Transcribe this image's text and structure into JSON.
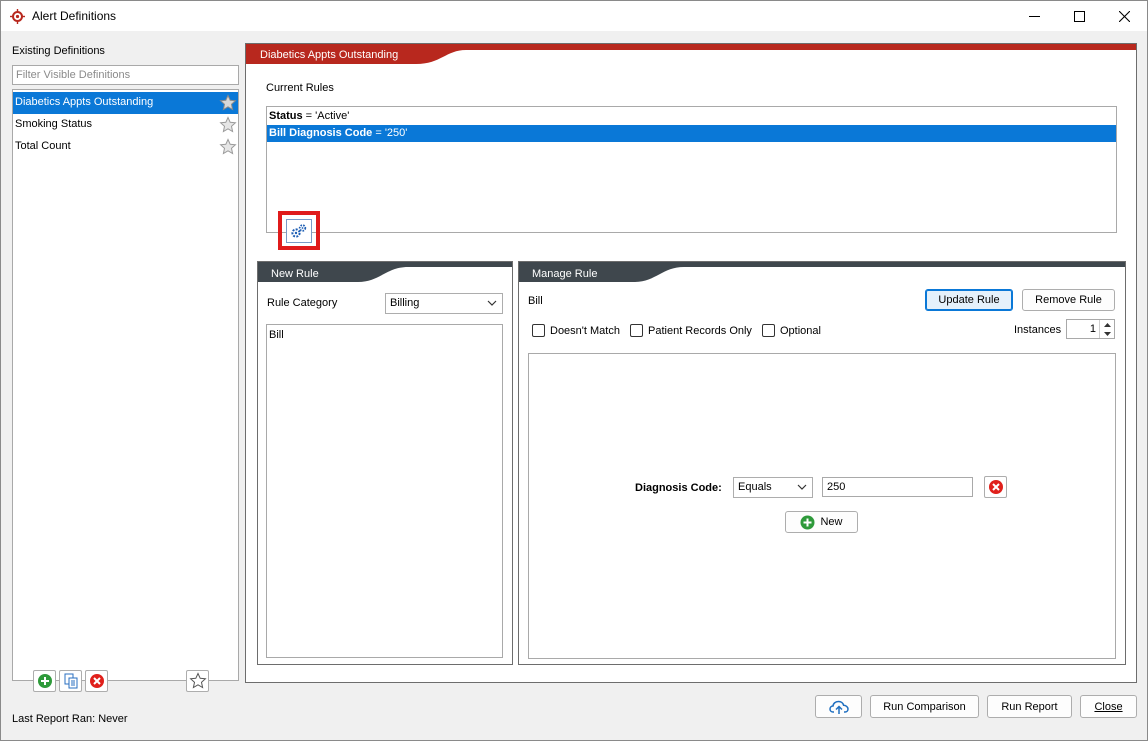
{
  "window": {
    "title": "Alert Definitions",
    "accent_color": "#b8281e",
    "selection_color": "#0a78d7"
  },
  "sidebar": {
    "heading": "Existing Definitions",
    "filter_placeholder": "Filter Visible Definitions",
    "items": [
      {
        "label": "Diabetics Appts Outstanding",
        "selected": true,
        "icon": "star-icon"
      },
      {
        "label": "Smoking Status",
        "selected": false,
        "icon": "star-icon"
      },
      {
        "label": "Total Count",
        "selected": false,
        "icon": "star-icon"
      }
    ],
    "toolbar_icons": [
      "add-icon",
      "copy-icon",
      "delete-icon",
      "star-icon"
    ],
    "last_report": "Last Report Ran: Never"
  },
  "definition": {
    "tab_title": "Diabetics Appts Outstanding",
    "current_rules_label": "Current Rules",
    "rules": [
      {
        "field": "Status",
        "expr": " = 'Active'",
        "selected": false
      },
      {
        "field": "Bill Diagnosis Code",
        "expr": " = '250'",
        "selected": true
      }
    ],
    "settings_icon": "gears-icon"
  },
  "new_rule": {
    "tab_title": "New Rule",
    "category_label": "Rule Category",
    "category_value": "Billing",
    "items": [
      "Bill"
    ]
  },
  "manage_rule": {
    "tab_title": "Manage Rule",
    "rule_name": "Bill",
    "update_label": "Update Rule",
    "remove_label": "Remove Rule",
    "doesnt_match_label": "Doesn't Match",
    "patient_records_label": "Patient Records Only",
    "optional_label": "Optional",
    "instances_label": "Instances",
    "instances_value": "1",
    "condition": {
      "label": "Diagnosis Code:",
      "operator": "Equals",
      "value": "250"
    },
    "new_label": "New"
  },
  "footer": {
    "upload_icon": "cloud-upload-icon",
    "run_comparison_label": "Run Comparison",
    "run_report_label": "Run Report",
    "close_label": "Close"
  }
}
